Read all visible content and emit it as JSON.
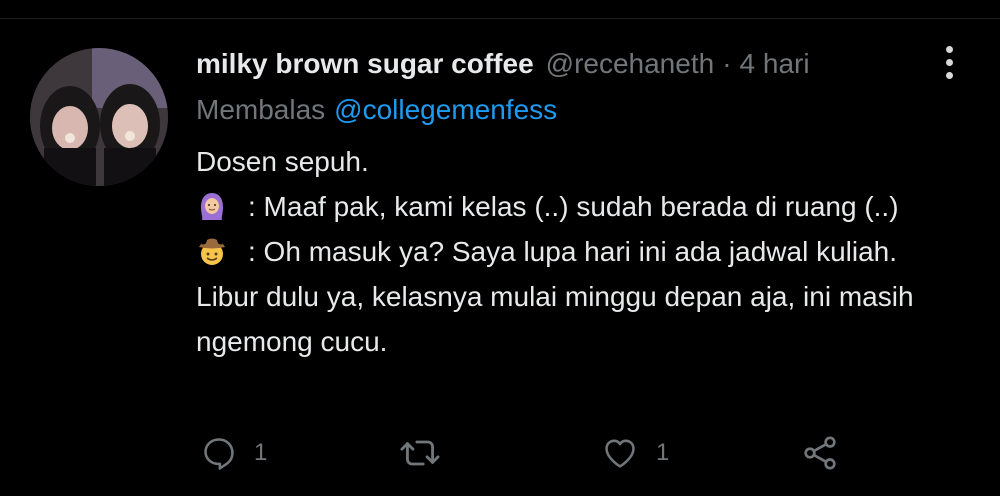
{
  "tweet": {
    "display_name": "milky brown sugar coffee",
    "handle": "@recehaneth",
    "separator": "·",
    "time": "4 hari",
    "reply_prefix": "Membalas",
    "reply_to": "@collegemenfess",
    "text": {
      "line1": "Dosen sepuh.",
      "line2": ": Maaf pak, kami kelas (..) sudah berada di ruang (..)",
      "line2_emoji": "woman-with-headscarf-emoji",
      "line3": ": Oh masuk ya? Saya lupa hari ini ada jadwal kuliah. Libur dulu ya, kelasnya mulai minggu depan aja, ini masih ngemong cucu.",
      "line3_emoji": "cowboy-face-emoji"
    }
  },
  "actions": {
    "reply_count": "1",
    "retweet_count": "",
    "like_count": "1"
  },
  "colors": {
    "background": "#000000",
    "text": "#e7e9ea",
    "secondary": "#71767b",
    "accent": "#1d9bf0"
  }
}
